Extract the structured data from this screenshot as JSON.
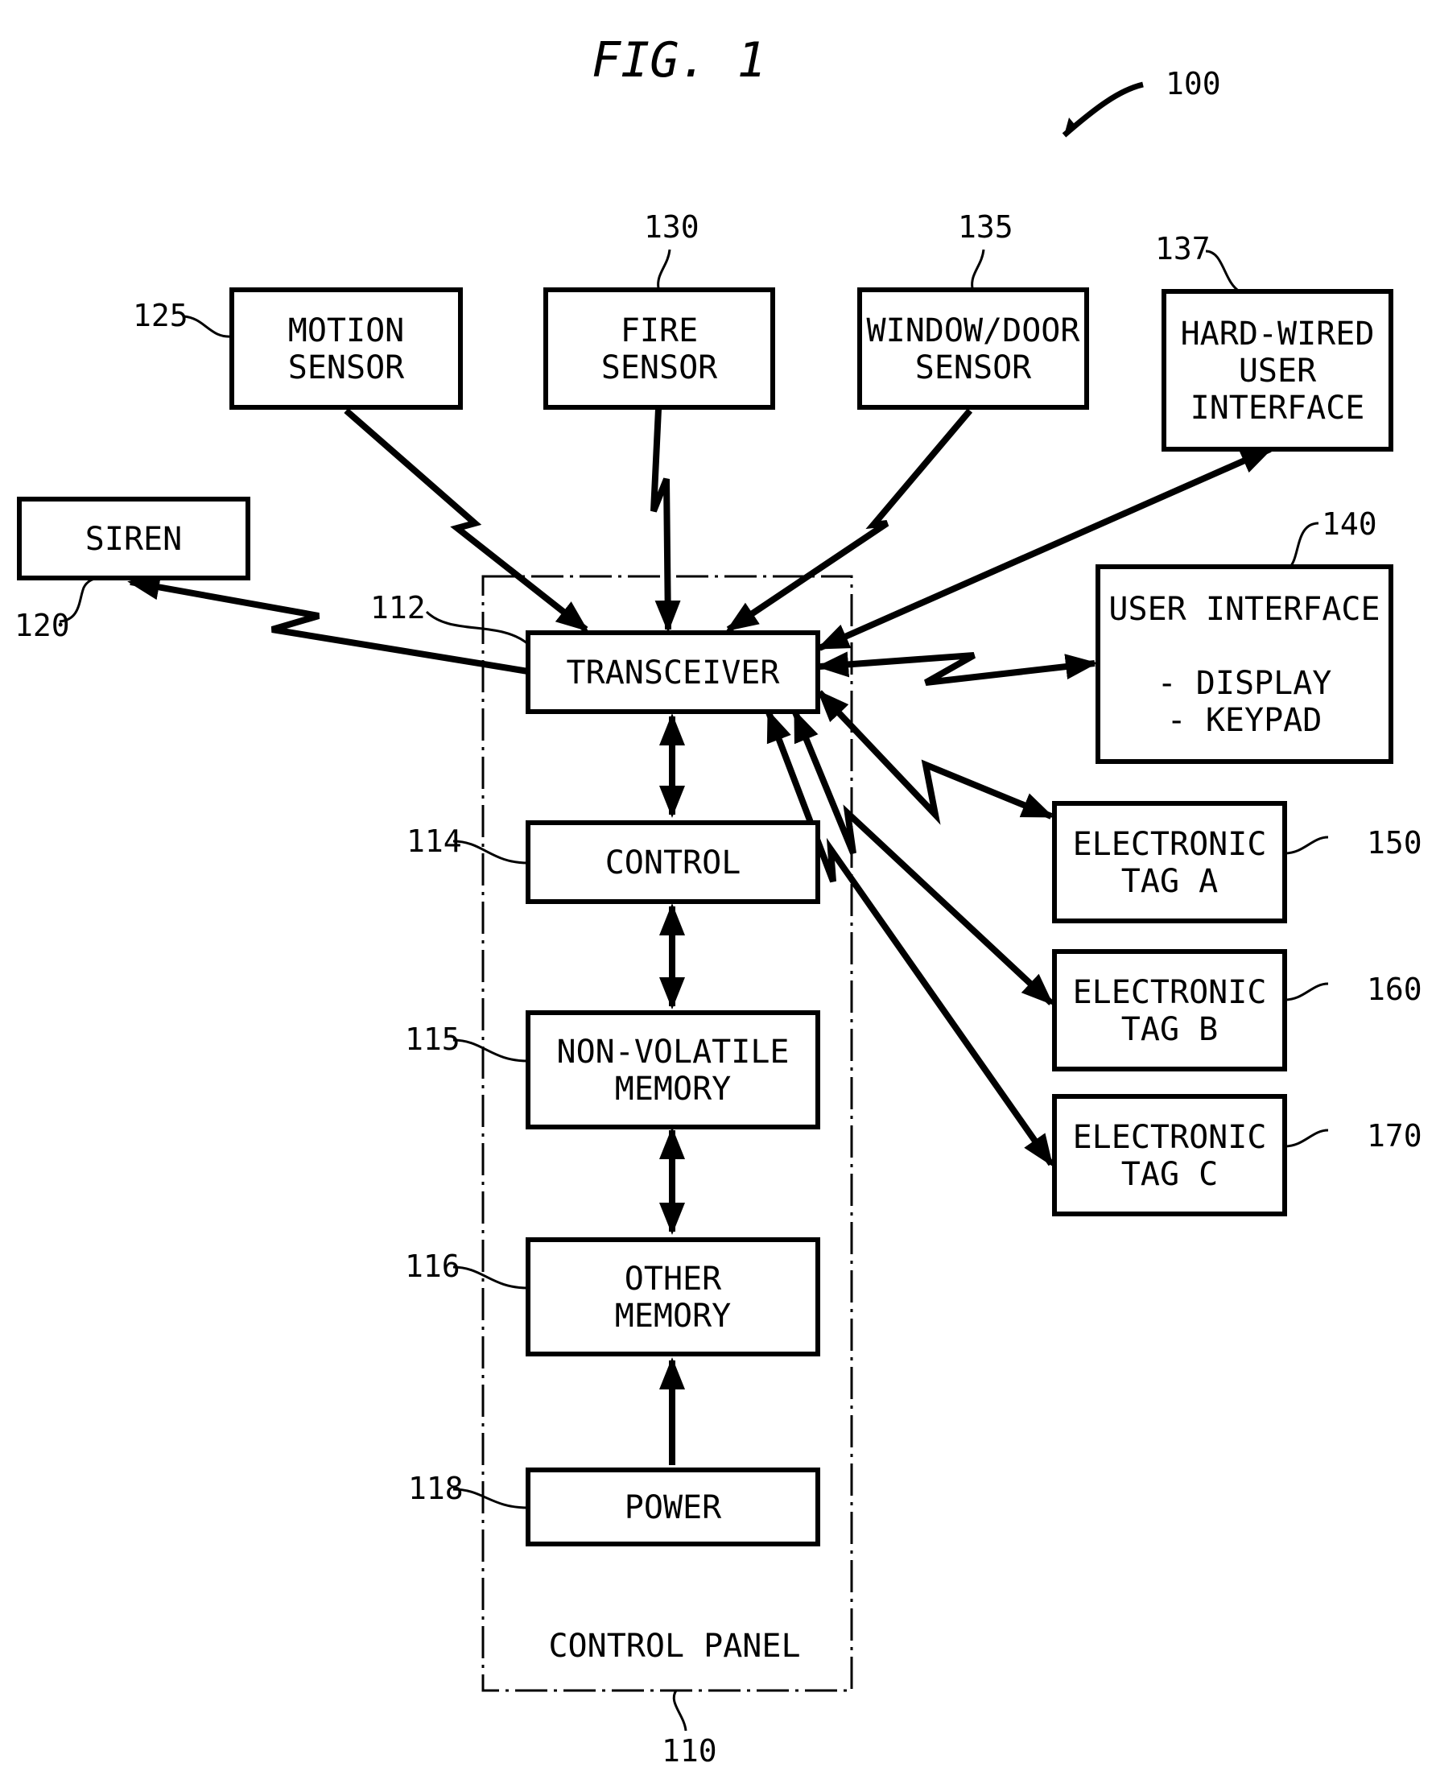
{
  "figure": {
    "title": "FIG. 1",
    "system_ref": "100"
  },
  "control_panel": {
    "label": "CONTROL PANEL",
    "ref": "110",
    "blocks": [
      {
        "id": "transceiver",
        "ref": "112",
        "lines": [
          "TRANSCEIVER"
        ]
      },
      {
        "id": "control",
        "ref": "114",
        "lines": [
          "CONTROL"
        ]
      },
      {
        "id": "non-volatile-memory",
        "ref": "115",
        "lines": [
          "NON-VOLATILE",
          "MEMORY"
        ]
      },
      {
        "id": "other-memory",
        "ref": "116",
        "lines": [
          "OTHER",
          "MEMORY"
        ]
      },
      {
        "id": "power",
        "ref": "118",
        "lines": [
          "POWER"
        ]
      }
    ]
  },
  "peripherals": [
    {
      "id": "siren",
      "ref": "120",
      "lines": [
        "SIREN"
      ]
    },
    {
      "id": "motion-sensor",
      "ref": "125",
      "lines": [
        "MOTION",
        "SENSOR"
      ]
    },
    {
      "id": "fire-sensor",
      "ref": "130",
      "lines": [
        "FIRE",
        "SENSOR"
      ]
    },
    {
      "id": "window-door-sensor",
      "ref": "135",
      "lines": [
        "WINDOW/DOOR",
        "SENSOR"
      ]
    },
    {
      "id": "hard-wired-user-interface",
      "ref": "137",
      "lines": [
        "HARD-WIRED",
        "USER",
        "INTERFACE"
      ]
    },
    {
      "id": "user-interface",
      "ref": "140",
      "lines": [
        "USER INTERFACE",
        "",
        "- DISPLAY",
        "- KEYPAD"
      ]
    },
    {
      "id": "electronic-tag-a",
      "ref": "150",
      "lines": [
        "ELECTRONIC",
        "TAG A"
      ]
    },
    {
      "id": "electronic-tag-b",
      "ref": "160",
      "lines": [
        "ELECTRONIC",
        "TAG B"
      ]
    },
    {
      "id": "electronic-tag-c",
      "ref": "170",
      "lines": [
        "ELECTRONIC",
        "TAG C"
      ]
    }
  ],
  "connections": [
    {
      "from": "motion-sensor",
      "to": "transceiver",
      "type": "wireless",
      "direction": "to"
    },
    {
      "from": "fire-sensor",
      "to": "transceiver",
      "type": "wireless",
      "direction": "to"
    },
    {
      "from": "window-door-sensor",
      "to": "transceiver",
      "type": "wireless",
      "direction": "to"
    },
    {
      "from": "hard-wired-user-interface",
      "to": "transceiver",
      "type": "wired",
      "direction": "both"
    },
    {
      "from": "transceiver",
      "to": "siren",
      "type": "wireless",
      "direction": "to"
    },
    {
      "from": "user-interface",
      "to": "transceiver",
      "type": "wireless",
      "direction": "both"
    },
    {
      "from": "transceiver",
      "to": "electronic-tag-a",
      "type": "wireless",
      "direction": "both"
    },
    {
      "from": "transceiver",
      "to": "electronic-tag-b",
      "type": "wireless",
      "direction": "both"
    },
    {
      "from": "transceiver",
      "to": "electronic-tag-c",
      "type": "wireless",
      "direction": "both"
    },
    {
      "from": "transceiver",
      "to": "control",
      "type": "wired",
      "direction": "both"
    },
    {
      "from": "control",
      "to": "non-volatile-memory",
      "type": "wired",
      "direction": "both"
    },
    {
      "from": "non-volatile-memory",
      "to": "other-memory",
      "type": "wired",
      "direction": "both"
    },
    {
      "from": "power",
      "to": "other-memory",
      "type": "wired",
      "direction": "to"
    }
  ]
}
